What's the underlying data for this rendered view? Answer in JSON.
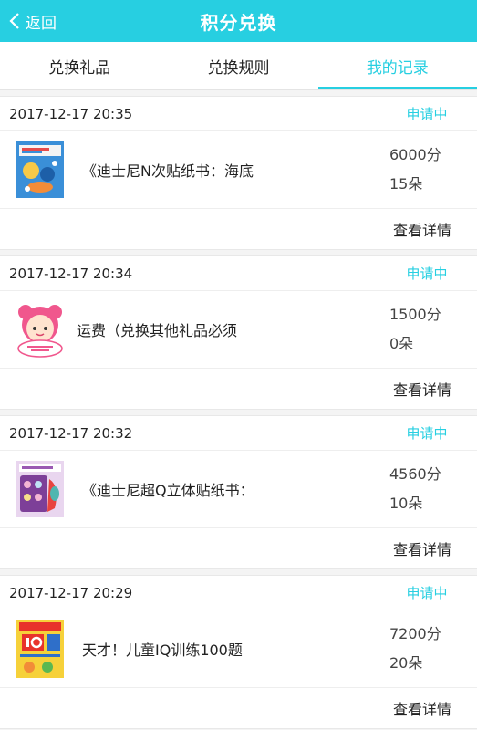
{
  "header": {
    "back_label": "返回",
    "title": "积分兑换"
  },
  "tabs": [
    {
      "label": "兑换礼品",
      "active": false
    },
    {
      "label": "兑换规则",
      "active": false
    },
    {
      "label": "我的记录",
      "active": true
    }
  ],
  "colors": {
    "accent": "#27cfe1"
  },
  "records": [
    {
      "date": "2017-12-17 20:35",
      "status": "申请中",
      "name": "《迪士尼N次贴纸书：海底",
      "points": "6000分",
      "flowers": "15朵",
      "detail": "查看详情",
      "thumb_icon": "book-cover-sea-icon"
    },
    {
      "date": "2017-12-17 20:34",
      "status": "申请中",
      "name": "运费（兑换其他礼品必须",
      "points": "1500分",
      "flowers": "0朵",
      "detail": "查看详情",
      "thumb_icon": "shipping-character-icon"
    },
    {
      "date": "2017-12-17 20:32",
      "status": "申请中",
      "name": "《迪士尼超Q立体贴纸书：",
      "points": "4560分",
      "flowers": "10朵",
      "detail": "查看详情",
      "thumb_icon": "book-cover-princess-icon"
    },
    {
      "date": "2017-12-17 20:29",
      "status": "申请中",
      "name": "天才！儿童IQ训练100题",
      "points": "7200分",
      "flowers": "20朵",
      "detail": "查看详情",
      "thumb_icon": "book-cover-iq-icon"
    }
  ]
}
